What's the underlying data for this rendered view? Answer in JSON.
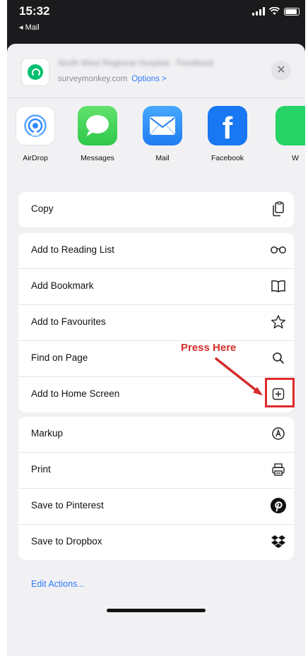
{
  "status": {
    "time": "15:32",
    "back_label": "◂ Mail"
  },
  "header": {
    "site_title": "North West Regional Hospital - Feedback",
    "site_domain": "surveymonkey.com",
    "options_label": "Options >",
    "close": "✕"
  },
  "apps": [
    {
      "label": "AirDrop",
      "icon": "airdrop-icon",
      "color": "#2f8cff"
    },
    {
      "label": "Messages",
      "icon": "messages-icon",
      "color": "#34c759"
    },
    {
      "label": "Mail",
      "icon": "mail-icon",
      "color": "#1f7cf0"
    },
    {
      "label": "Facebook",
      "icon": "facebook-icon",
      "color": "#1877f2"
    },
    {
      "label": "W",
      "icon": "whatsapp-icon",
      "color": "#25d366"
    }
  ],
  "groups": [
    [
      {
        "label": "Copy",
        "icon": "copy-icon"
      }
    ],
    [
      {
        "label": "Add to Reading List",
        "icon": "glasses-icon"
      },
      {
        "label": "Add Bookmark",
        "icon": "book-icon"
      },
      {
        "label": "Add to Favourites",
        "icon": "star-icon"
      },
      {
        "label": "Find on Page",
        "icon": "search-icon"
      },
      {
        "label": "Add to Home Screen",
        "icon": "add-square-icon"
      }
    ],
    [
      {
        "label": "Markup",
        "icon": "markup-icon"
      },
      {
        "label": "Print",
        "icon": "print-icon"
      },
      {
        "label": "Save to Pinterest",
        "icon": "pinterest-icon"
      },
      {
        "label": "Save to Dropbox",
        "icon": "dropbox-icon"
      }
    ]
  ],
  "edit_actions": "Edit Actions...",
  "annotation": {
    "text": "Press Here",
    "color": "#d42c2c"
  }
}
